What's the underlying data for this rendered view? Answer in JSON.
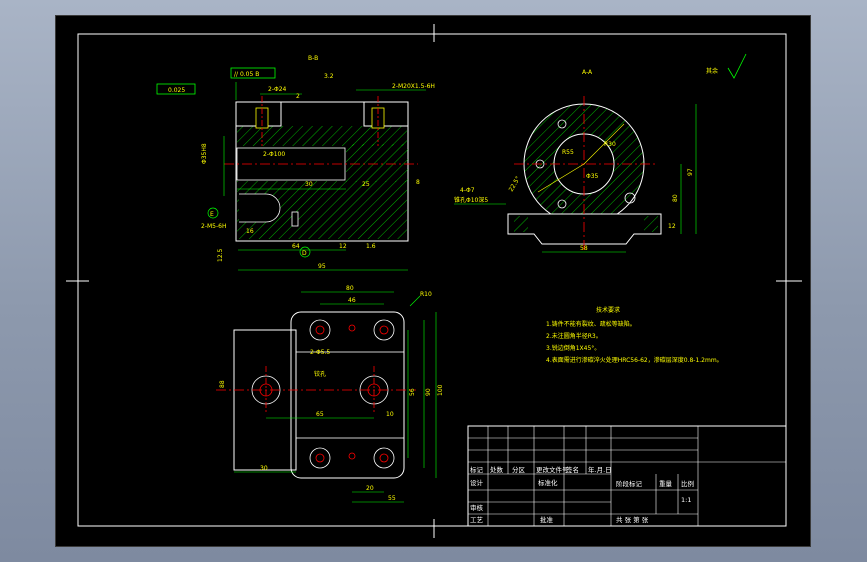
{
  "colors": {
    "background": "#000000",
    "part_outline": "#ffffff",
    "dimension": "#00ff00",
    "hatch": "#00ff00",
    "center_line": "#ff0000",
    "hidden_line": "#ffff00",
    "text": "#ffff00"
  },
  "views": {
    "section_bb_label": "B-B",
    "section_aa_label": "A-A",
    "roughness_note": "其余"
  },
  "dims_section_bb": {
    "flatness": "// 0.05 B",
    "cylindricity": "0.025",
    "hole_pair": "2-Φ24",
    "depth_hint": "2",
    "thread_note": "2-M20X1.5-6H",
    "ra": "3.2",
    "pin": "2-Φ100",
    "bore": "Φ35H8",
    "len30": "30",
    "len25": "25",
    "len8": "8",
    "len64": "64",
    "len95": "95",
    "len16": "16",
    "len12": "12",
    "hole_note": "2-M5-6H",
    "ra2": "1.6",
    "ra3": "12.5",
    "mark_e": "E",
    "mark_d": "D"
  },
  "dims_section_aa": {
    "r55": "R55",
    "r30": "R30",
    "d35": "Φ35",
    "h97": "97",
    "h80": "80",
    "w58": "58",
    "h12": "12",
    "note_hole": "4-Φ7",
    "note_hole2": "锥孔Φ10深5",
    "ang": "22.5°"
  },
  "dims_plan": {
    "r10": "R10",
    "top80": "80",
    "top46": "46",
    "note": "2-Φ5.5",
    "note2": "铰孔",
    "w65": "65",
    "w10": "10",
    "w30": "30",
    "w20": "20",
    "w55": "55",
    "v56": "56",
    "v90": "90",
    "v100": "100",
    "v88": "88"
  },
  "tech_req": {
    "title": "技术要求",
    "items": [
      "1.铸件不能有裂纹、疏松等缺陷。",
      "2.未注圆角半径R3。",
      "3.锐边倒角1X45°。",
      "4.表面需进行渗碳淬火处理HRC56-62，渗碳层深度0.8-1.2mm。"
    ]
  },
  "title_block": {
    "row_labels": [
      "标记",
      "处数",
      "分区",
      "更改文件号",
      "签名",
      "年.月.日"
    ],
    "design": "设计",
    "standard": "标准化",
    "check": "审核",
    "process": "工艺",
    "approve": "批准",
    "stage": "阶段标记",
    "weight": "重量",
    "scale": "比例",
    "scale_value": "1:1",
    "sheet_info": "共  张  第  张"
  }
}
